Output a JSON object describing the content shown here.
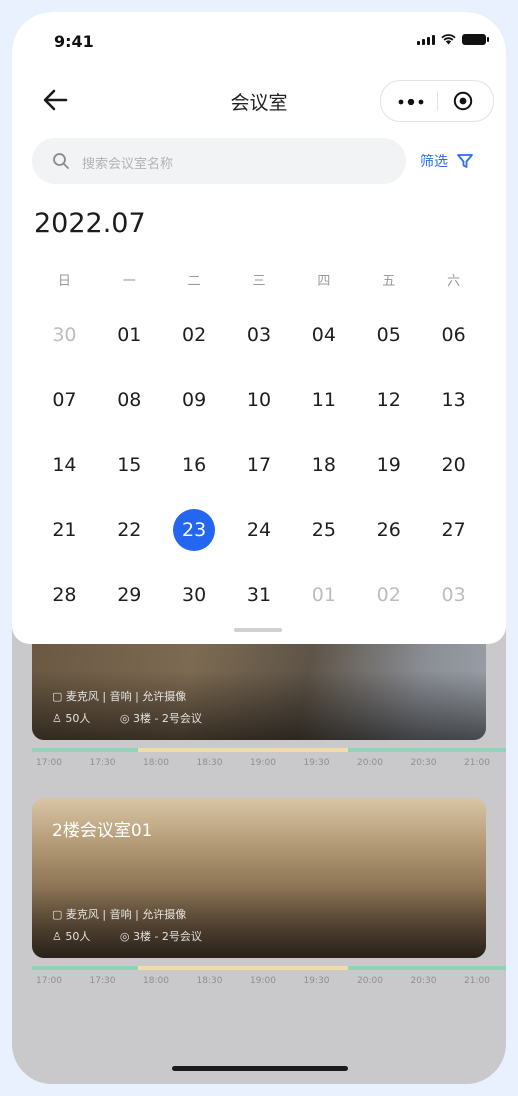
{
  "status": {
    "time": "9:41"
  },
  "nav": {
    "title": "会议室"
  },
  "search": {
    "placeholder": "搜索会议室名称"
  },
  "filter": {
    "label": "筛选"
  },
  "calendar": {
    "month": "2022.07",
    "weekdays": [
      "日",
      "一",
      "二",
      "三",
      "四",
      "五",
      "六"
    ],
    "weeks": [
      [
        {
          "d": "30",
          "muted": true
        },
        {
          "d": "01"
        },
        {
          "d": "02"
        },
        {
          "d": "03"
        },
        {
          "d": "04"
        },
        {
          "d": "05"
        },
        {
          "d": "06"
        }
      ],
      [
        {
          "d": "07"
        },
        {
          "d": "08"
        },
        {
          "d": "09"
        },
        {
          "d": "10"
        },
        {
          "d": "11"
        },
        {
          "d": "12"
        },
        {
          "d": "13"
        }
      ],
      [
        {
          "d": "14"
        },
        {
          "d": "15"
        },
        {
          "d": "16"
        },
        {
          "d": "17"
        },
        {
          "d": "18"
        },
        {
          "d": "19"
        },
        {
          "d": "20"
        }
      ],
      [
        {
          "d": "21"
        },
        {
          "d": "22"
        },
        {
          "d": "23",
          "selected": true
        },
        {
          "d": "24"
        },
        {
          "d": "25"
        },
        {
          "d": "26"
        },
        {
          "d": "27"
        }
      ],
      [
        {
          "d": "28"
        },
        {
          "d": "29"
        },
        {
          "d": "30"
        },
        {
          "d": "31"
        },
        {
          "d": "01",
          "muted": true
        },
        {
          "d": "02",
          "muted": true
        },
        {
          "d": "03",
          "muted": true
        }
      ]
    ]
  },
  "rooms": [
    {
      "name": "",
      "tags": "麦克风 | 音响 | 允许摄像",
      "capacity": "50人",
      "location": "3楼 - 2号会议"
    },
    {
      "name": "2楼会议室01",
      "tags": "麦克风 | 音响 | 允许摄像",
      "capacity": "50人",
      "location": "3楼 - 2号会议"
    }
  ],
  "times": [
    "17:00",
    "17:30",
    "18:00",
    "18:30",
    "19:00",
    "19:30",
    "20:00",
    "20:30",
    "21:00"
  ],
  "colors": {
    "accent": "#2466f0",
    "free": "#8fd3b9",
    "booked": "#f0dca6"
  }
}
